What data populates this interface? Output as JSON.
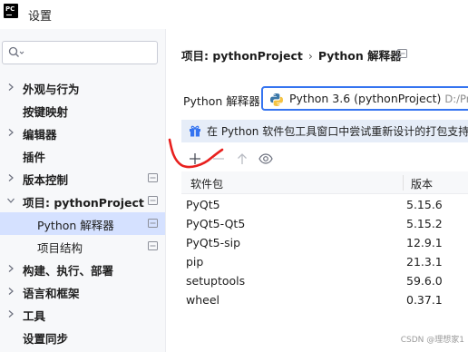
{
  "window": {
    "app_logo": "PC",
    "title": "设置"
  },
  "search": {
    "placeholder": "",
    "value": ""
  },
  "sidebar": {
    "items": [
      {
        "label": "外观与行为",
        "expandable": true
      },
      {
        "label": "按键映射",
        "expandable": false
      },
      {
        "label": "编辑器",
        "expandable": true
      },
      {
        "label": "插件",
        "expandable": false
      },
      {
        "label": "版本控制",
        "expandable": true
      },
      {
        "label": "项目: pythonProject",
        "expandable": true,
        "expanded": true
      },
      {
        "label": "Python 解释器",
        "child": true,
        "selected": true
      },
      {
        "label": "项目结构",
        "child": true
      },
      {
        "label": "构建、执行、部署",
        "expandable": true
      },
      {
        "label": "语言和框架",
        "expandable": true
      },
      {
        "label": "工具",
        "expandable": true
      },
      {
        "label": "设置同步",
        "expandable": false
      }
    ]
  },
  "breadcrumb": {
    "project": "项目: pythonProject",
    "separator": "›",
    "current": "Python 解释器"
  },
  "interpreter": {
    "label": "Python 解释器:",
    "value": "Python 3.6 (pythonProject)",
    "path": "D:/Projects"
  },
  "banner": {
    "icon": "gift-icon",
    "text": "在 Python 软件包工具窗口中尝试重新设计的打包支持。"
  },
  "toolbar": {
    "buttons": [
      "add-icon",
      "remove-icon",
      "upgrade-icon",
      "show-icon"
    ]
  },
  "packages": {
    "columns": {
      "name": "软件包",
      "version": "版本"
    },
    "rows": [
      {
        "name": "PyQt5",
        "version": "5.15.6"
      },
      {
        "name": "PyQt5-Qt5",
        "version": "5.15.2"
      },
      {
        "name": "PyQt5-sip",
        "version": "12.9.1"
      },
      {
        "name": "pip",
        "version": "21.3.1"
      },
      {
        "name": "setuptools",
        "version": "59.6.0"
      },
      {
        "name": "wheel",
        "version": "0.37.1"
      }
    ]
  },
  "watermark": "CSDN @理想家1",
  "colors": {
    "accent": "#3574f0",
    "selection": "#d5e1ff",
    "annotation": "#e8201e",
    "banner_bg": "#e6edf8"
  }
}
